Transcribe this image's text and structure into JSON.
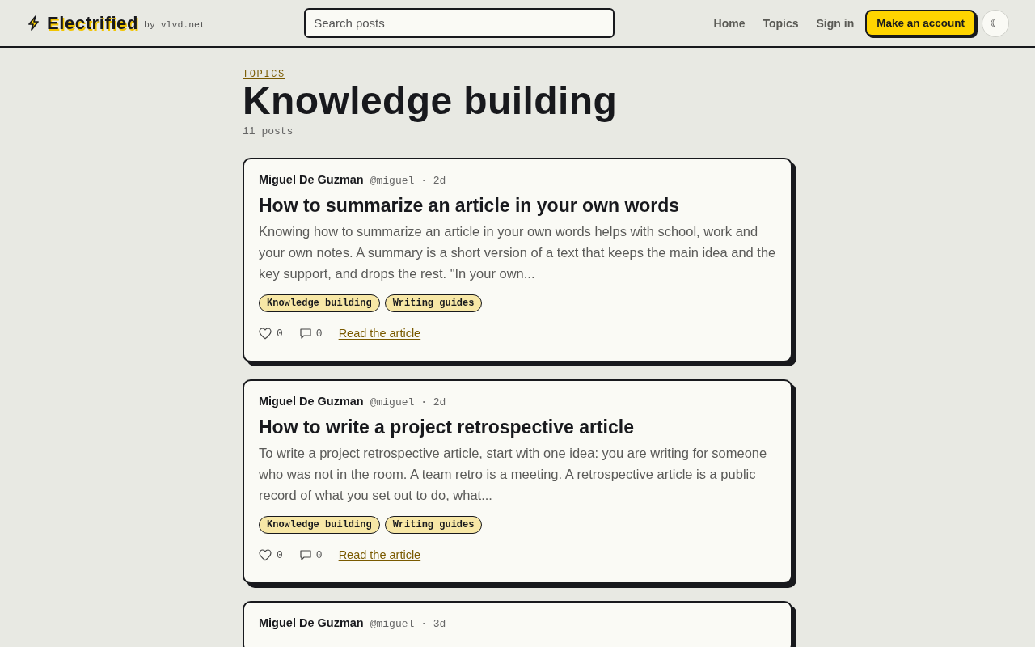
{
  "header": {
    "logo": "Electrified",
    "byline": "by vlvd.net",
    "search": {
      "placeholder": "Search posts"
    },
    "nav": [
      "Home",
      "Topics",
      "Sign in"
    ],
    "cta": "Make an account",
    "theme_toggle": "☾"
  },
  "topic": {
    "eyebrow": "TOPICS",
    "title": "Knowledge building",
    "count": "11 posts"
  },
  "posts": [
    {
      "author": "Miguel De Guzman",
      "meta": "@miguel · 2d",
      "title": "How to summarize an article in your own words",
      "excerpt": "Knowing how to summarize an article in your own words helps with school, work and your own notes. A summary is a short version of a text that keeps the main idea and the key support, and drops the rest. \"In your own...",
      "tags": [
        "Knowledge building",
        "Writing guides"
      ],
      "likes": "0",
      "comments": "0",
      "link": "Read the article"
    },
    {
      "author": "Miguel De Guzman",
      "meta": "@miguel · 2d",
      "title": "How to write a project retrospective article",
      "excerpt": "To write a project retrospective article, start with one idea: you are writing for someone who was not in the room. A team retro is a meeting. A retrospective article is a public record of what you set out to do, what...",
      "tags": [
        "Knowledge building",
        "Writing guides"
      ],
      "likes": "0",
      "comments": "0",
      "link": "Read the article"
    },
    {
      "author": "Miguel De Guzman",
      "meta": "@miguel · 3d"
    }
  ]
}
